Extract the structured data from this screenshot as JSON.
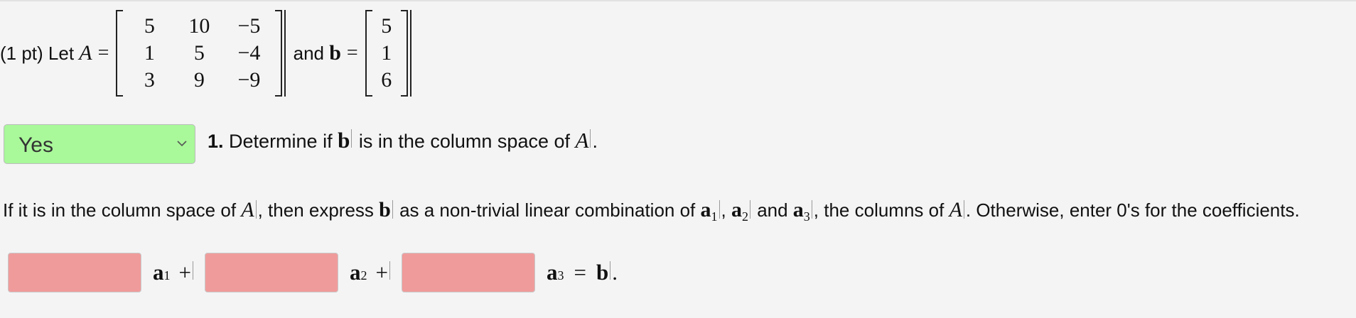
{
  "problem": {
    "prefix": "(1 pt) Let ",
    "matrix_var": "A",
    "equals": "=",
    "and_text": " and ",
    "vector_var": "b",
    "matrix_A": [
      [
        "5",
        "10",
        "−5"
      ],
      [
        "1",
        "5",
        "−4"
      ],
      [
        "3",
        "9",
        "−9"
      ]
    ],
    "vector_b": [
      [
        "5"
      ],
      [
        "1"
      ],
      [
        "6"
      ]
    ]
  },
  "question1": {
    "select_value": "Yes",
    "number": "1.",
    "text_before": " Determine if ",
    "vector_var": "b",
    "text_middle": " is in the column space of ",
    "matrix_var": "A",
    "text_end": "."
  },
  "instructions": {
    "part1": "If it is in the column space of ",
    "A1": "A",
    "part2": ", then express ",
    "b": "b",
    "part3": " as a non-trivial linear combination of ",
    "a": "a",
    "sub1": "1",
    "comma1": ", ",
    "sub2": "2",
    "and": " and ",
    "sub3": "3",
    "part4": ", the columns of ",
    "A2": "A",
    "part5": ". Otherwise, enter 0's for the coefficients."
  },
  "combination": {
    "coef1_value": "",
    "coef2_value": "",
    "coef3_value": "",
    "vec": "a",
    "sub1": "1",
    "sub2": "2",
    "sub3": "3",
    "plus": "+",
    "equals": "=",
    "rhs": "b",
    "period": "."
  },
  "colors": {
    "select_correct": "#a9f89a",
    "input_incorrect": "#f09b9b",
    "background": "#f4f4f4"
  }
}
